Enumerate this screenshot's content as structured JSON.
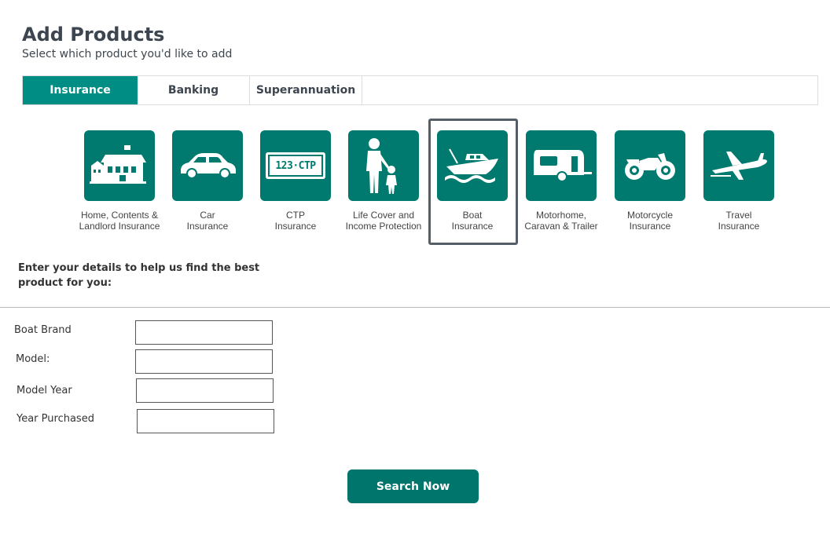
{
  "header": {
    "title": "Add Products",
    "subtitle": "Select which product you'd like to add"
  },
  "tabs": [
    {
      "label": "Insurance",
      "active": true
    },
    {
      "label": "Banking",
      "active": false
    },
    {
      "label": "Superannuation",
      "active": false
    }
  ],
  "products": [
    {
      "line1": "Home, Contents &",
      "line2": "Landlord Insurance",
      "icon": "house-icon"
    },
    {
      "line1": "Car",
      "line2": "Insurance",
      "icon": "car-icon"
    },
    {
      "line1": "CTP",
      "line2": "Insurance",
      "icon": "number-plate-icon",
      "plate_text": "123·CTP"
    },
    {
      "line1": "Life Cover and",
      "line2": "Income Protection",
      "icon": "parent-child-icon"
    },
    {
      "line1": "Boat",
      "line2": "Insurance",
      "icon": "boat-icon",
      "selected": true
    },
    {
      "line1": "Motorhome,",
      "line2": "Caravan & Trailer",
      "icon": "caravan-icon"
    },
    {
      "line1": "Motorcycle",
      "line2": "Insurance",
      "icon": "motorcycle-icon"
    },
    {
      "line1": "Travel",
      "line2": "Insurance",
      "icon": "airplane-icon"
    }
  ],
  "details": {
    "heading": "Enter your details to help us find the best product for you:"
  },
  "form": {
    "fields": [
      {
        "label": "Boat Brand",
        "value": ""
      },
      {
        "label": "Model:",
        "value": ""
      },
      {
        "label": "Model Year",
        "value": ""
      },
      {
        "label": "Year Purchased",
        "value": ""
      }
    ],
    "submit_label": "Search Now"
  },
  "colors": {
    "brand_teal": "#008e84",
    "tile_teal": "#00796e",
    "button_teal": "#00756c",
    "heading_grey": "#3d4650"
  }
}
